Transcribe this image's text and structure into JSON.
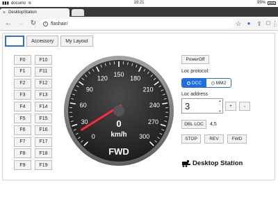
{
  "statusbar": {
    "carrier": "docomo",
    "time": "19:21",
    "battery": "99%"
  },
  "tab": {
    "title": "DesktopStation",
    "close": "×"
  },
  "addressbar": {
    "back": "←",
    "forward": "→",
    "reload": "↻",
    "url": "flashair/",
    "star": "☆",
    "mic": "🎤",
    "share": "⇪",
    "tabs": "▢",
    "menu": "⋮"
  },
  "toolbar": {
    "selected_tab": "",
    "accessory_label": "Accessory",
    "layout_label": "My Layout"
  },
  "functions_left": [
    "F0",
    "F1",
    "F2",
    "F3",
    "F4",
    "F5",
    "F6",
    "F7",
    "F8",
    "F9"
  ],
  "functions_right": [
    "F10",
    "F11",
    "F12",
    "F13",
    "F14",
    "F15",
    "F16",
    "F17",
    "F18",
    "F19"
  ],
  "speedometer": {
    "speed": "0",
    "unit": "km/h",
    "direction": "FWD",
    "ticks": [
      "0",
      "30",
      "60",
      "90",
      "120",
      "150",
      "180",
      "210",
      "240",
      "270",
      "300"
    ],
    "max": 300,
    "needle_value": 20,
    "needle_color": "#ff2a3a"
  },
  "controls": {
    "power_off": "PowerOff",
    "loc_protocol_label": "Loc protocol:",
    "dcc": "DCC",
    "mm2": "MM2",
    "loc_address_label": "Loc address",
    "address_value": "3",
    "plus": "+",
    "minus": "-",
    "dbl_loc": "DBL LOC",
    "dbl_value": "4,5",
    "stop": "STOP",
    "rev": "REV",
    "fwd": "FWD"
  },
  "logo": {
    "text": "Desktop Station"
  },
  "colors": {
    "accent": "#1e6fe0",
    "tab_bar": "#3a3a3a"
  }
}
